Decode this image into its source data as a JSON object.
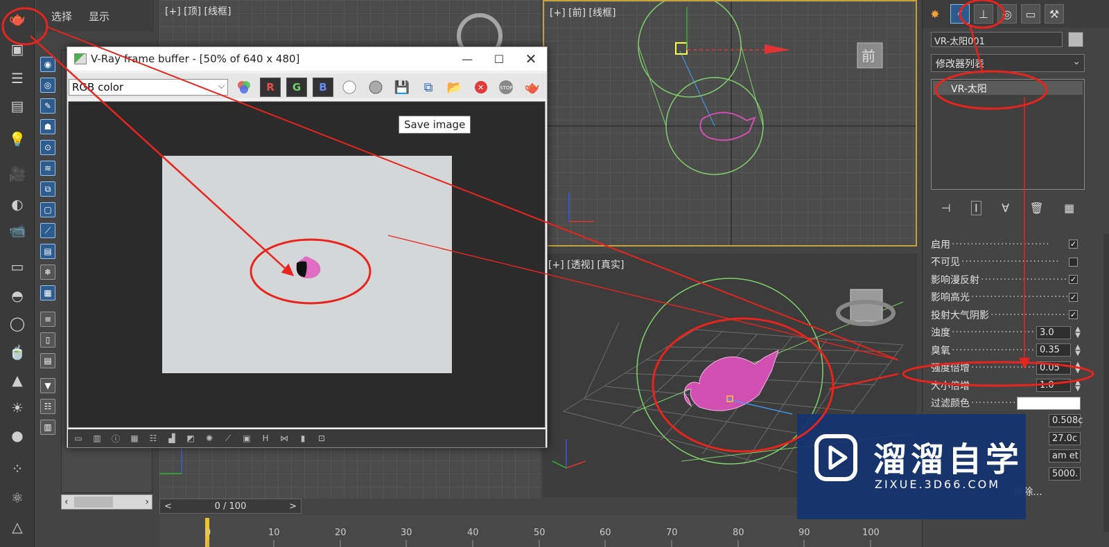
{
  "left_panel": {
    "menu": [
      "选择",
      "显示"
    ]
  },
  "viewports": {
    "top_label": "[+] [顶] [线框]",
    "front_label": "[+] [前] [线框]",
    "persp_label": "[+] [透视] [真实]",
    "viewcube_front": "前"
  },
  "timeline": {
    "frame_display": "0 / 100",
    "prev": "<",
    "next": ">",
    "ticks": [
      "0",
      "10",
      "20",
      "30",
      "40",
      "50",
      "60",
      "70",
      "80",
      "90",
      "100"
    ]
  },
  "vfb": {
    "title": "V-Ray frame buffer - [50% of 640 x 480]",
    "channel": "RGB color",
    "ch_r": "R",
    "ch_g": "G",
    "ch_b": "B",
    "tooltip": "Save image",
    "bottom_h": "H",
    "stop_label": "STOP"
  },
  "command_panel": {
    "object_name": "VR-太阳001",
    "modifier_list": "修改器列表",
    "stack_item": "VR-太阳",
    "params": [
      {
        "label": "启用",
        "type": "check",
        "checked": true
      },
      {
        "label": "不可见",
        "type": "check",
        "checked": false
      },
      {
        "label": "影响漫反射",
        "type": "check",
        "checked": true
      },
      {
        "label": "影响高光",
        "type": "check",
        "checked": true
      },
      {
        "label": "投射大气阴影",
        "type": "check",
        "checked": true
      },
      {
        "label": "浊度",
        "type": "spin",
        "value": "3.0"
      },
      {
        "label": "臭氧",
        "type": "spin",
        "value": "0.35"
      },
      {
        "label": "强度倍增",
        "type": "spin",
        "value": "0.05"
      },
      {
        "label": "大小倍增",
        "type": "spin",
        "value": "1.0"
      },
      {
        "label": "过滤颜色",
        "type": "color",
        "value": "#ffffff"
      }
    ],
    "partial_values": [
      "0.508c",
      "27.0c",
      "am et",
      "5000."
    ],
    "exclude_button": "排除..."
  },
  "watermark": {
    "title": "溜溜自学",
    "subtitle": "ZIXUE.3D66.COM"
  },
  "colors": {
    "annotation": "#e8241c",
    "selected_blue": "#2b5a8d",
    "object_pink": "#d14fb0",
    "sun_wire": "#7fd36a"
  }
}
